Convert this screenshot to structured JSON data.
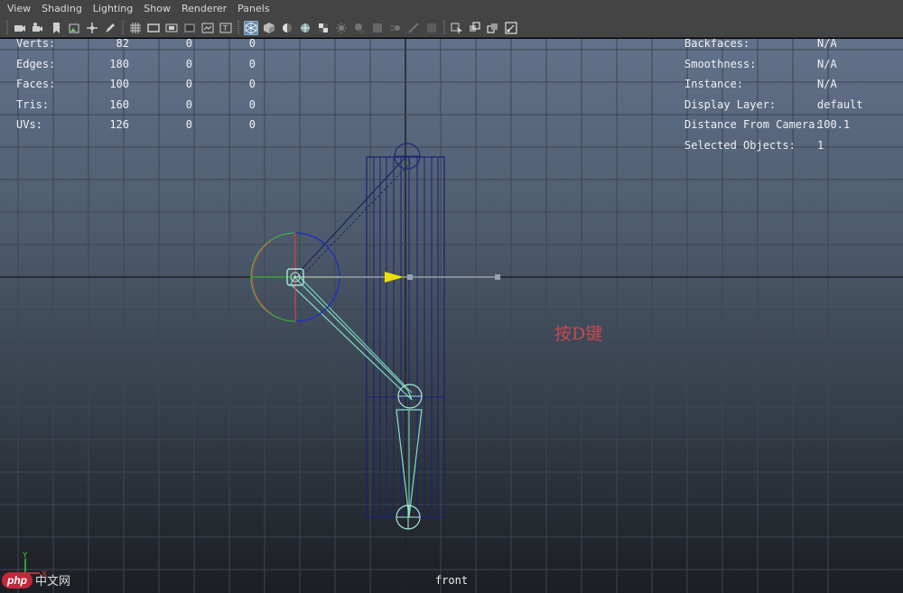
{
  "menu": [
    "View",
    "Shading",
    "Lighting",
    "Show",
    "Renderer",
    "Panels"
  ],
  "toolbar": {
    "groups": [
      [
        "camera-icon",
        "camera-attributes-icon",
        "bookmark-icon",
        "image-plane-icon",
        "2d-pan-zoom-icon",
        "grease-pencil-icon"
      ],
      [
        "grid-icon",
        "film-gate-icon",
        "resolution-gate-icon",
        "gate-mask-icon",
        "field-chart-icon",
        "safe-action-icon"
      ],
      [
        "wireframe-icon",
        "smooth-shade-icon",
        "default-lighting-icon",
        "shaded-wireframe-icon",
        "textured-icon",
        "use-all-lights-icon",
        "shadows-icon",
        "ambient-occlusion-icon",
        "motion-blur-icon",
        "anti-aliasing-icon",
        "depth-of-field-icon"
      ],
      [
        "isolate-select-icon",
        "xray-icon",
        "xray-active-icon",
        "xray-joints-icon"
      ]
    ],
    "active": "wireframe-icon",
    "dimmed": [
      "use-all-lights-icon",
      "shadows-icon",
      "ambient-occlusion-icon",
      "motion-blur-icon",
      "anti-aliasing-icon",
      "depth-of-field-icon"
    ]
  },
  "hud_left": [
    {
      "label": "Verts:",
      "values": [
        "82",
        "0",
        "0"
      ]
    },
    {
      "label": "Edges:",
      "values": [
        "180",
        "0",
        "0"
      ]
    },
    {
      "label": "Faces:",
      "values": [
        "100",
        "0",
        "0"
      ]
    },
    {
      "label": "Tris:",
      "values": [
        "160",
        "0",
        "0"
      ]
    },
    {
      "label": "UVs:",
      "values": [
        "126",
        "0",
        "0"
      ]
    }
  ],
  "hud_right": [
    {
      "label": "Backfaces:",
      "value": "N/A"
    },
    {
      "label": "Smoothness:",
      "value": "N/A"
    },
    {
      "label": "Instance:",
      "value": "N/A"
    },
    {
      "label": "Display Layer:",
      "value": "default"
    },
    {
      "label": "Distance From Camera:",
      "value": "100.1"
    },
    {
      "label": "Selected Objects:",
      "value": "1"
    }
  ],
  "annotation": "按D键",
  "camera_label": "front",
  "axis_labels": {
    "y": "Y",
    "x": "X"
  },
  "watermark": {
    "badge": "php",
    "text": "中文网"
  },
  "colors": {
    "mesh": "#1a2070",
    "joint": "#a8e8d0",
    "bone": "#7fe0c8",
    "manip_x": "#d84040",
    "manip_y": "#40c040",
    "manip_z": "#2030c0",
    "move_arrow": "#f0e000",
    "annotation": "#c8484f"
  }
}
